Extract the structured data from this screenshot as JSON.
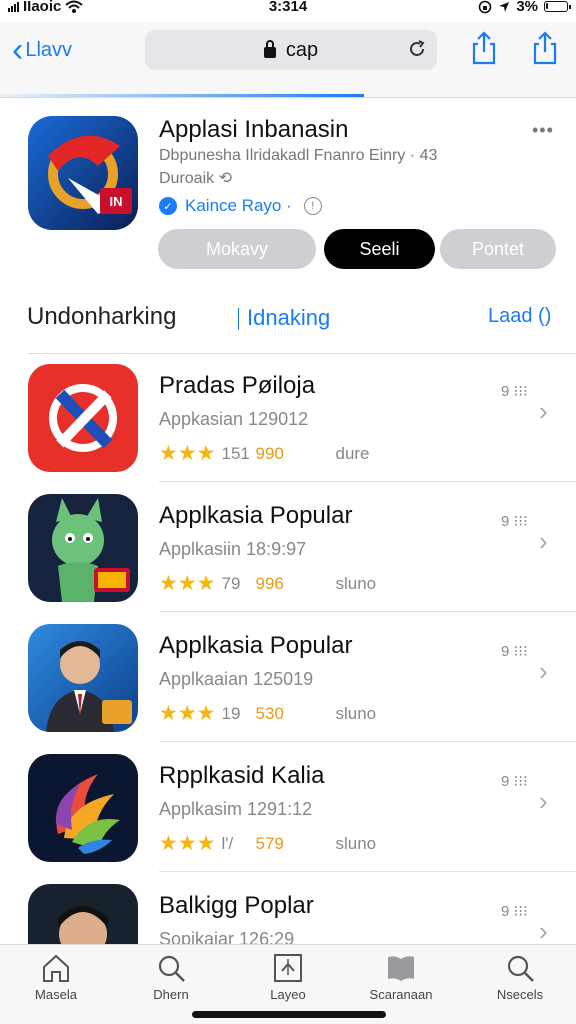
{
  "status_bar": {
    "carrier": "IIaoic",
    "time": "3:314",
    "battery": "3%",
    "battery_level": 0.1
  },
  "nav": {
    "back_label": "Llavv",
    "url": "cap"
  },
  "featured": {
    "title": "Applasi Inbanasin",
    "subtitle_line1": "Dbpunesha Ilridakadl Fnanro Einry · 43",
    "subtitle_line2": "Duroaik",
    "developer": "Kaince Rayo ·",
    "buttons": [
      "Mokavy",
      "Seeli",
      "Pontet"
    ],
    "colors": {
      "accent": "#1a7cf5"
    }
  },
  "section": {
    "left": "Undonharking",
    "middle": "Idnaking",
    "right": "Laad ()"
  },
  "apps": [
    {
      "name": "Pradas Pøiloja",
      "category": "Appkasian 129012",
      "rating_count": "151",
      "price": "990",
      "action": "dure",
      "menu": "9",
      "stars": "★★★",
      "icon": "red-x-logo-icon"
    },
    {
      "name": "Applkasia Popular",
      "category": "Applkasiin 18:9:97",
      "rating_count": "79",
      "price": "996",
      "action": "sluno",
      "menu": "9",
      "stars": "★★★",
      "icon": "green-cat-mascot-icon"
    },
    {
      "name": "Applkasia Popular",
      "category": "Applkaaian 125019",
      "rating_count": "19",
      "price": "530",
      "action": "sluno",
      "menu": "9",
      "stars": "★★★",
      "icon": "portrait-man-icon"
    },
    {
      "name": "Rpplkasid Kalia",
      "category": "Applkasim 1291:12",
      "rating_count": "l'/",
      "price": "579",
      "action": "sluno",
      "menu": "9",
      "stars": "★★★",
      "icon": "rainbow-swirl-icon"
    },
    {
      "name": "Balkiɡg Poplar",
      "category": "Sopikaiar 126:29",
      "rating_count": "",
      "price": "",
      "action": "",
      "menu": "9",
      "stars": "",
      "icon": "portrait-boy-icon"
    }
  ],
  "tabs": [
    {
      "label": "Masela",
      "icon": "home-icon"
    },
    {
      "label": "Dhern",
      "icon": "search-icon"
    },
    {
      "label": "Layeo",
      "icon": "layers-icon"
    },
    {
      "label": "Scaranaan",
      "icon": "book-icon"
    },
    {
      "label": "Nsecels",
      "icon": "search-icon"
    }
  ]
}
